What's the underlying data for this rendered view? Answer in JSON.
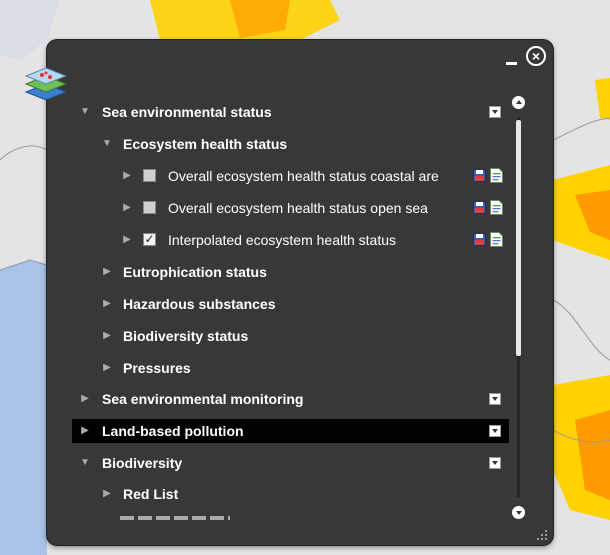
{
  "panel": {
    "minimize_icon": "minimize-icon",
    "close_icon": "close-icon",
    "close_glyph": "×",
    "layers_icon": "layers-stack-icon"
  },
  "tree": [
    {
      "label": "Sea environmental status",
      "level": 0,
      "expanded": true,
      "dropdown": true
    },
    {
      "label": "Ecosystem health status",
      "level": 1,
      "expanded": true
    },
    {
      "label": "Overall ecosystem health status coastal are",
      "level": 2,
      "checked": false,
      "actions": [
        "save-icon",
        "document-icon"
      ]
    },
    {
      "label": "Overall ecosystem health status open sea",
      "level": 2,
      "checked": false,
      "actions": [
        "save-icon",
        "document-icon"
      ]
    },
    {
      "label": "Interpolated ecosystem health status",
      "level": 2,
      "checked": true,
      "actions": [
        "save-icon",
        "document-icon"
      ]
    },
    {
      "label": "Eutrophication status",
      "level": 1,
      "expanded": false
    },
    {
      "label": "Hazardous substances",
      "level": 1,
      "expanded": false
    },
    {
      "label": "Biodiversity status",
      "level": 1,
      "expanded": false
    },
    {
      "label": "Pressures",
      "level": 1,
      "expanded": false
    },
    {
      "label": "Sea environmental monitoring",
      "level": 0,
      "expanded": false,
      "dropdown": true
    },
    {
      "label": "Land-based pollution",
      "level": 0,
      "expanded": false,
      "dropdown": true,
      "selected": true
    },
    {
      "label": "Biodiversity",
      "level": 0,
      "expanded": true,
      "dropdown": true
    },
    {
      "label": "Red List",
      "level": 1,
      "expanded": false
    }
  ],
  "colors": {
    "panel_bg": "#383838",
    "selected_row": "#000000",
    "map_land": "#e4e4e4",
    "map_sea": "#a9c3e8",
    "heat_yellow": "#ffd200",
    "heat_orange": "#ff9a00"
  }
}
